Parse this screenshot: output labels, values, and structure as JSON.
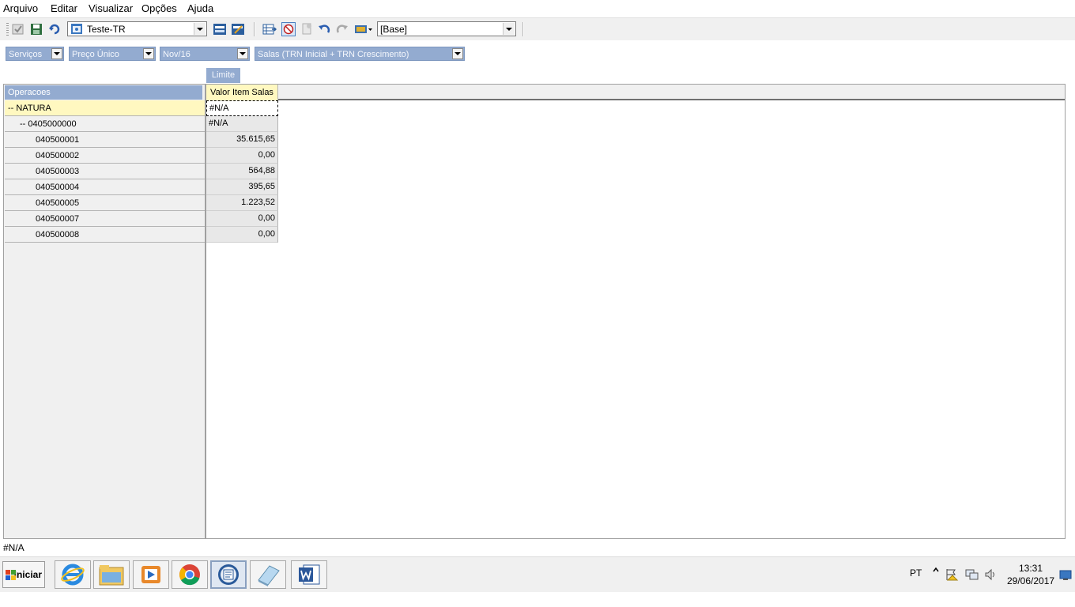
{
  "menu": [
    "Arquivo",
    "Editar",
    "Visualizar",
    "Opções",
    "Ajuda"
  ],
  "toolbar": {
    "scenario_value": "Teste-TR",
    "version_value": "[Base]"
  },
  "filters": [
    "Serviços",
    "Preço Único",
    "Nov/16",
    "Salas (TRN Inicial + TRN Crescimento)"
  ],
  "left_panel": {
    "header": "Operacoes",
    "rows": [
      "-- NATURA",
      "-- 0405000000",
      "040500001",
      "040500002",
      "040500003",
      "040500004",
      "040500005",
      "040500007",
      "040500008"
    ]
  },
  "grid": {
    "tab_label": "Limite",
    "column_header": "Valor Item Salas",
    "values": [
      "#N/A",
      "#N/A",
      "35.615,65",
      "0,00",
      "564,88",
      "395,65",
      "1.223,52",
      "0,00",
      "0,00"
    ]
  },
  "status": {
    "cell_ref": "#N/A"
  },
  "taskbar": {
    "start_label": "Iniciar",
    "language": "PT",
    "time": "13:31",
    "date": "29/06/2017"
  }
}
